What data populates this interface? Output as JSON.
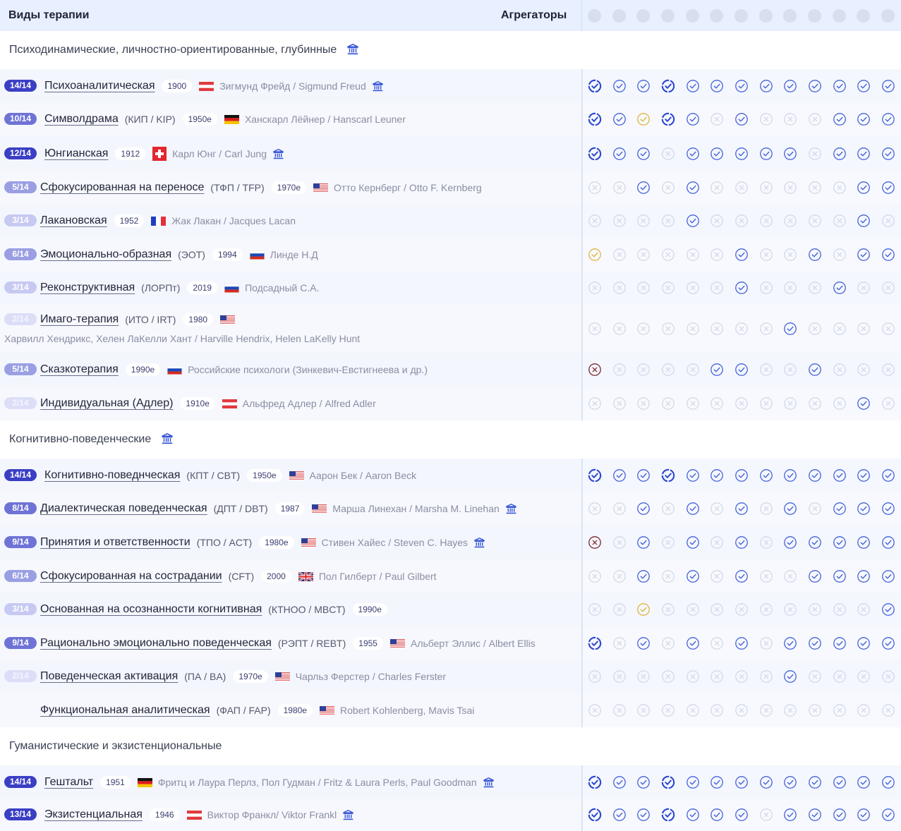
{
  "header": {
    "title": "Виды терапии",
    "aggregators_label": "Агрегаторы",
    "aggregator_count": 13
  },
  "sections": [
    {
      "title": "Психодинамические, личностно-ориентированные, глубинные",
      "has_icon": true,
      "rows": [
        {
          "score": "14/14",
          "name": "Психоаналитическая",
          "abbr": "",
          "year": "1900",
          "flag": "austria",
          "author": "Зигмунд Фрейд / Sigmund Freud",
          "museum": true,
          "status": [
            "vb",
            "v",
            "v",
            "vb",
            "v",
            "v",
            "v",
            "v",
            "v",
            "v",
            "v",
            "v",
            "v"
          ]
        },
        {
          "score": "10/14",
          "name": "Символдрама",
          "abbr": "(КИП / KIP)",
          "year": "1950е",
          "flag": "germany",
          "author": "Ханскарл Лёйнер / Hanscarl Leuner",
          "museum": false,
          "status": [
            "vb",
            "v",
            "y",
            "vb",
            "v",
            "x",
            "v",
            "x",
            "x",
            "x",
            "v",
            "v",
            "v"
          ]
        },
        {
          "score": "12/14",
          "name": "Юнгианская",
          "abbr": "",
          "year": "1912",
          "flag": "switzerland",
          "author": "Карл Юнг / Carl Jung",
          "museum": true,
          "status": [
            "vb",
            "v",
            "v",
            "x",
            "v",
            "v",
            "v",
            "v",
            "v",
            "x",
            "v",
            "v",
            "v"
          ]
        },
        {
          "score": "5/14",
          "name": "Сфокусированная на переносе",
          "abbr": "(ТФП / TFP)",
          "year": "1970е",
          "flag": "usa",
          "author": "Отто Кернберг / Otto F. Kernberg",
          "museum": false,
          "status": [
            "x",
            "x",
            "v",
            "x",
            "v",
            "x",
            "x",
            "x",
            "x",
            "x",
            "x",
            "v",
            "v"
          ]
        },
        {
          "score": "3/14",
          "name": "Лакановская",
          "abbr": "",
          "year": "1952",
          "flag": "france",
          "author": "Жак Лакан / Jacques Lacan",
          "museum": false,
          "status": [
            "x",
            "x",
            "x",
            "x",
            "v",
            "x",
            "x",
            "x",
            "x",
            "x",
            "x",
            "v",
            "x"
          ]
        },
        {
          "score": "6/14",
          "name": "Эмоционально-образная",
          "abbr": "(ЭОТ)",
          "year": "1994",
          "flag": "russia",
          "author": "Линде Н.Д",
          "museum": false,
          "status": [
            "y",
            "x",
            "x",
            "x",
            "x",
            "x",
            "v",
            "x",
            "x",
            "v",
            "x",
            "v",
            "v"
          ]
        },
        {
          "score": "3/14",
          "name": "Реконструктивная",
          "abbr": "(ЛОРПт)",
          "year": "2019",
          "flag": "russia",
          "author": "Подсадный С.А.",
          "museum": false,
          "status": [
            "x",
            "x",
            "x",
            "x",
            "x",
            "x",
            "v",
            "x",
            "x",
            "x",
            "v",
            "x",
            "x"
          ]
        },
        {
          "score": "2/14",
          "name": "Имаго-терапия",
          "abbr": "(ИТО / IRT)",
          "year": "1980",
          "flag": "usa",
          "author": "",
          "author2": "Харвилл Хендрикс, Хелен ЛаКелли Хант / Harville Hendrix, Helen LaKelly Hunt",
          "museum": false,
          "status": [
            "x",
            "x",
            "x",
            "x",
            "x",
            "x",
            "x",
            "x",
            "v",
            "x",
            "x",
            "x",
            "x"
          ]
        },
        {
          "score": "5/14",
          "name": "Сказкотерапия",
          "abbr": "",
          "year": "1990е",
          "flag": "russia",
          "author": "Российские психологи (Зинкевич-Евстигнеева и др.)",
          "museum": false,
          "status": [
            "r",
            "x",
            "x",
            "x",
            "x",
            "v",
            "v",
            "x",
            "x",
            "v",
            "x",
            "x",
            "x"
          ]
        },
        {
          "score": "2/14",
          "name": "Индивидуальная (Адлер)",
          "abbr": "",
          "year": "1910е",
          "flag": "austria",
          "author": "Альфред Адлер / Alfred Adler",
          "museum": false,
          "status": [
            "x",
            "x",
            "x",
            "x",
            "x",
            "x",
            "x",
            "x",
            "x",
            "x",
            "x",
            "v",
            "x"
          ]
        }
      ]
    },
    {
      "title": "Когнитивно-поведенческие",
      "has_icon": true,
      "rows": [
        {
          "score": "14/14",
          "name": "Когнитивно-поведнческая",
          "abbr": "(КПТ / CBT)",
          "year": "1950е",
          "flag": "usa",
          "author": "Аарон Бек / Aaron Beck",
          "museum": false,
          "status": [
            "vb",
            "v",
            "v",
            "vb",
            "v",
            "v",
            "v",
            "v",
            "v",
            "v",
            "v",
            "v",
            "v"
          ]
        },
        {
          "score": "8/14",
          "name": "Диалектическая поведенческая",
          "abbr": "(ДПТ / DBT)",
          "year": "1987",
          "flag": "usa",
          "author": "Марша Линехан / Marsha M. Linehan",
          "museum": true,
          "status": [
            "x",
            "x",
            "v",
            "x",
            "v",
            "x",
            "v",
            "x",
            "v",
            "x",
            "v",
            "v",
            "v"
          ]
        },
        {
          "score": "9/14",
          "name": "Принятия и ответственности",
          "abbr": "(ТПО / ACT)",
          "year": "1980е",
          "flag": "usa",
          "author": "Стивен Хайес / Steven C. Hayes",
          "museum": true,
          "status": [
            "r",
            "x",
            "v",
            "x",
            "v",
            "x",
            "v",
            "x",
            "v",
            "v",
            "v",
            "v",
            "v"
          ]
        },
        {
          "score": "6/14",
          "name": "Сфокусированная на сострадании",
          "abbr": "(CFT)",
          "year": "2000",
          "flag": "uk",
          "author": "Пол Гилберт / Paul Gilbert",
          "museum": false,
          "status": [
            "x",
            "x",
            "v",
            "x",
            "v",
            "x",
            "v",
            "x",
            "x",
            "v",
            "v",
            "v",
            "v"
          ]
        },
        {
          "score": "3/14",
          "name": "Основанная на осознанности когнитивная",
          "abbr": "(КТНОО / MBCT)",
          "year": "1990е",
          "flag": "",
          "author": "",
          "museum": false,
          "status": [
            "x",
            "x",
            "y",
            "x",
            "x",
            "x",
            "x",
            "x",
            "x",
            "x",
            "x",
            "x",
            "v"
          ]
        },
        {
          "score": "9/14",
          "name": "Рационально эмоционально поведенческая",
          "abbr": "(РЭПТ / REBT)",
          "year": "1955",
          "flag": "usa",
          "author": "Альберт Эллис / Albert Ellis",
          "museum": false,
          "status": [
            "vb",
            "x",
            "v",
            "x",
            "v",
            "x",
            "v",
            "x",
            "v",
            "v",
            "v",
            "v",
            "v"
          ]
        },
        {
          "score": "2/14",
          "name": "Поведенческая активация",
          "abbr": "(ПА / BA)",
          "year": "1970е",
          "flag": "usa",
          "author": "Чарльз Ферстер / Charles Ferster",
          "museum": false,
          "status": [
            "x",
            "x",
            "x",
            "x",
            "x",
            "x",
            "x",
            "x",
            "v",
            "x",
            "x",
            "x",
            "x"
          ]
        },
        {
          "score": "",
          "name": "Функциональная аналитическая",
          "abbr": "(ФАП / FAP)",
          "year": "1980е",
          "flag": "usa",
          "author": "Robert Kohlenberg, Mavis Tsai",
          "museum": false,
          "status": [
            "x",
            "x",
            "x",
            "x",
            "x",
            "x",
            "x",
            "x",
            "x",
            "x",
            "x",
            "x",
            "x"
          ]
        }
      ]
    },
    {
      "title": "Гуманистические и экзистенциональные",
      "has_icon": false,
      "rows": [
        {
          "score": "14/14",
          "name": "Гештальт",
          "abbr": "",
          "year": "1951",
          "flag": "germany",
          "author": "Фритц и Лаура Перлз, Пол Гудман / Fritz & Laura Perls, Paul Goodman",
          "museum": true,
          "status": [
            "vb",
            "v",
            "v",
            "vb",
            "v",
            "v",
            "v",
            "v",
            "v",
            "v",
            "v",
            "v",
            "v"
          ]
        },
        {
          "score": "13/14",
          "name": "Экзистенциальная",
          "abbr": "",
          "year": "1946",
          "flag": "austria",
          "author": "Виктор Франкл/ Viktor Frankl",
          "museum": true,
          "status": [
            "vb",
            "v",
            "v",
            "vb",
            "v",
            "v",
            "v",
            "x",
            "v",
            "v",
            "v",
            "v",
            "v"
          ]
        }
      ]
    }
  ],
  "colors": {
    "accent": "#2f4fd6",
    "check_outline": "#4561d8",
    "yellow": "#e0b53a",
    "red": "#7a2530",
    "inactive": "#d3d8e8"
  }
}
